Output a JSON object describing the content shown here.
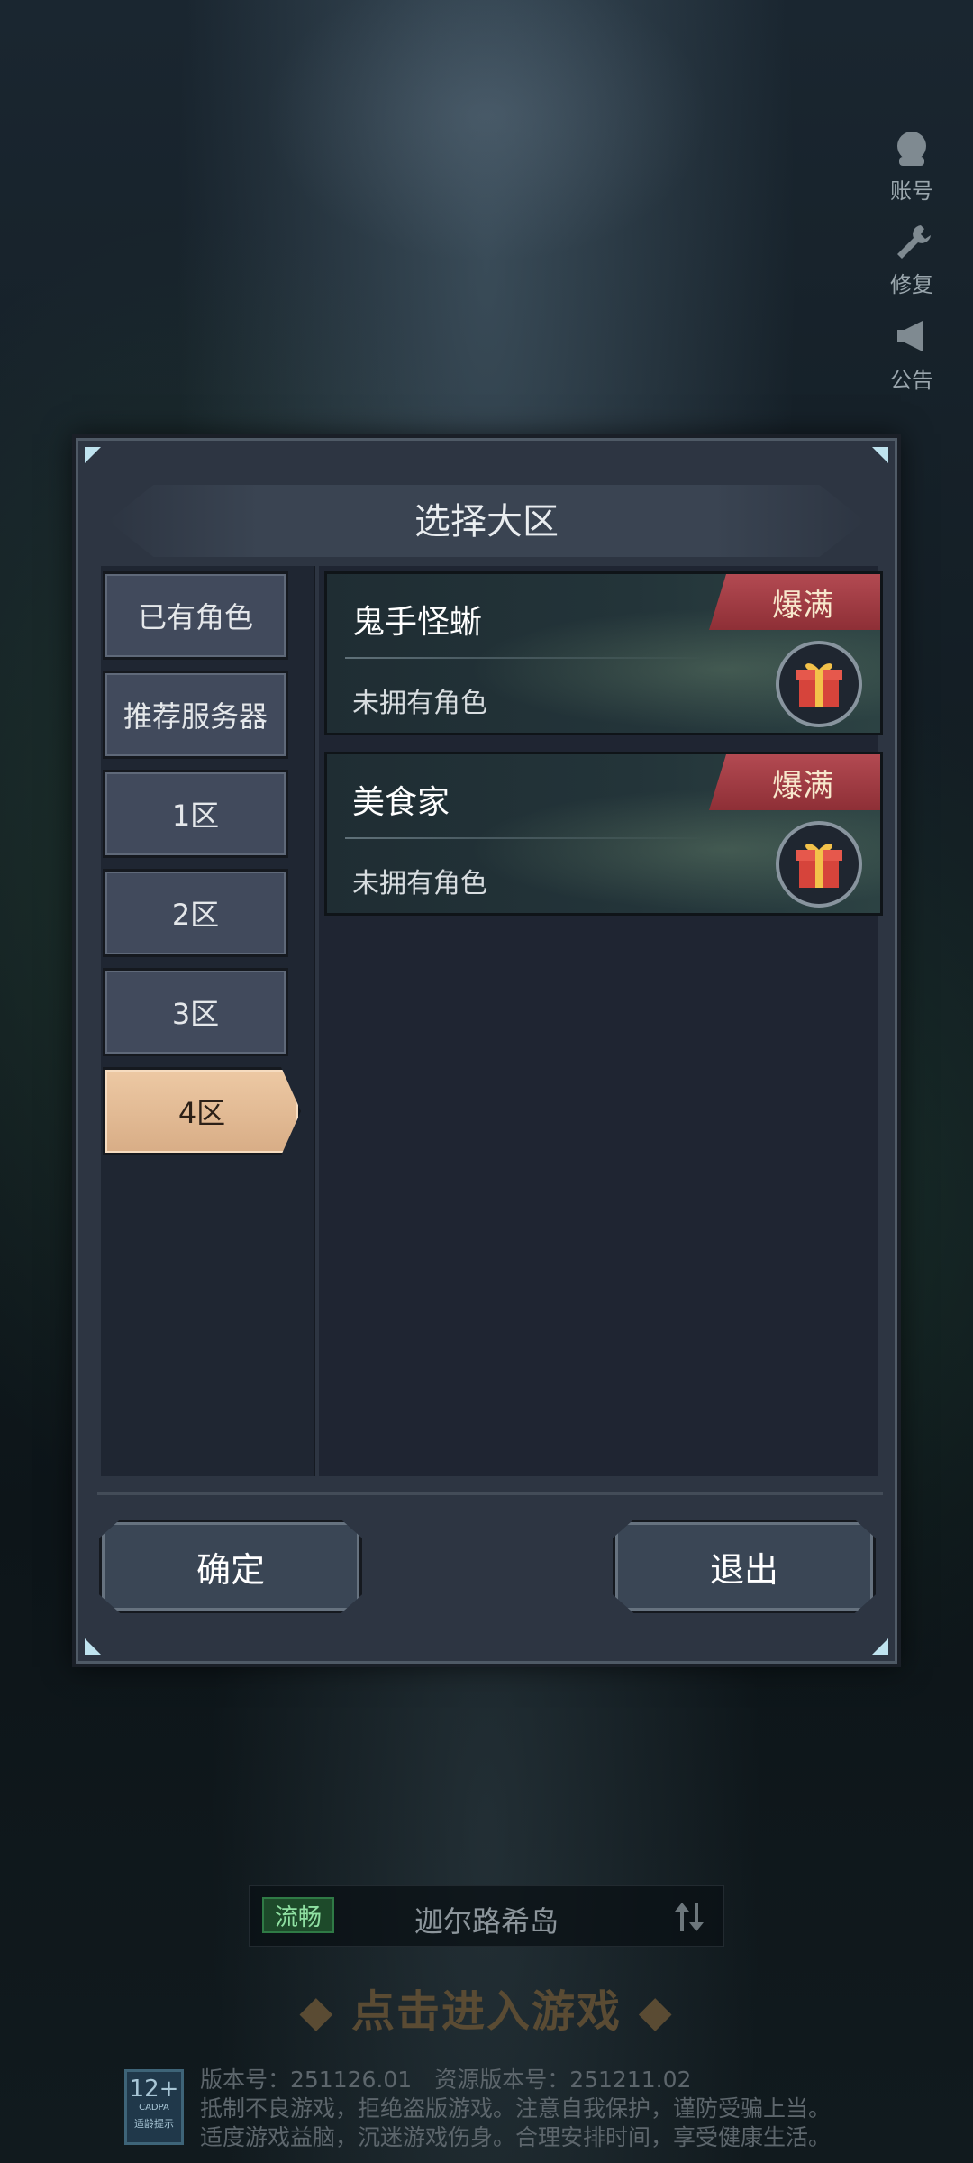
{
  "side_menu": [
    {
      "label": "账号",
      "icon": "account-icon"
    },
    {
      "label": "修复",
      "icon": "wrench-icon"
    },
    {
      "label": "公告",
      "icon": "megaphone-icon"
    }
  ],
  "dialog": {
    "title": "选择大区",
    "zones": [
      "已有角色",
      "推荐服务器",
      "1区",
      "2区",
      "3区",
      "4区"
    ],
    "active_zone": "4区",
    "servers": [
      {
        "name": "鬼手怪蜥",
        "subtitle": "未拥有角色",
        "badge": "爆满"
      },
      {
        "name": "美食家",
        "subtitle": "未拥有角色",
        "badge": "爆满"
      }
    ],
    "confirm_label": "确定",
    "exit_label": "退出"
  },
  "bottom": {
    "status": "流畅",
    "server_name": "迦尔路希岛",
    "enter_label": "◆ 点击进入游戏 ◆",
    "age_rating": "12+",
    "age_org": "CADPA",
    "age_caption": "适龄提示",
    "version_line": "版本号：251126.01　资源版本号：251211.02",
    "notice_line1": "抵制不良游戏，拒绝盗版游戏。注意自我保护，谨防受骗上当。",
    "notice_line2": "适度游戏益脑，沉迷游戏伤身。合理安排时间，享受健康生活。"
  },
  "colors": {
    "badge_red": "#a43c44",
    "active_zone": "#e8c39c",
    "status_green": "#2f7a45"
  }
}
